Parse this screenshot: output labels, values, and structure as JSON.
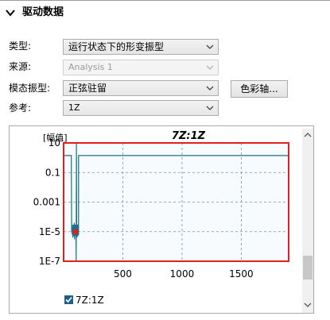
{
  "panel": {
    "title": "驱动数据"
  },
  "form": {
    "type": {
      "label": "类型:",
      "value": "运行状态下的形变振型"
    },
    "source": {
      "label": "来源:",
      "value": "Analysis 1",
      "disabled": true
    },
    "mode": {
      "label": "模态振型:",
      "value": "正弦驻留"
    },
    "reference": {
      "label": "参考:",
      "value": "1Z"
    },
    "color_axis_button": "色彩轴..."
  },
  "chart_data": {
    "type": "line",
    "title": "7Z:1Z",
    "ylabel": "[幅值]",
    "xlabel": "",
    "yscale": "log",
    "ylim": [
      1e-07,
      10
    ],
    "xlim": [
      0,
      1900
    ],
    "yticks": [
      {
        "value": 10,
        "label": "10"
      },
      {
        "value": 0.1,
        "label": "0.1"
      },
      {
        "value": 0.001,
        "label": "0.001"
      },
      {
        "value": 1e-05,
        "label": "1E-5"
      },
      {
        "value": 1e-07,
        "label": "1E-7"
      }
    ],
    "xticks": [
      {
        "value": 500,
        "label": "500"
      },
      {
        "value": 1000,
        "label": "1000"
      },
      {
        "value": 1500,
        "label": "1500"
      }
    ],
    "grid": true,
    "series": [
      {
        "name": "7Z:1Z",
        "color": "#1a6f8a",
        "x": [
          0,
          65,
          68,
          68.5,
          70,
          72,
          74,
          76,
          78,
          80,
          82,
          84,
          86,
          88,
          90,
          92,
          94,
          96,
          98,
          100,
          102,
          104,
          106,
          108,
          110,
          112,
          114,
          116,
          118,
          120,
          122,
          124,
          125,
          126,
          126.5,
          130,
          1900
        ],
        "y": [
          1.4,
          1.4,
          1e-05,
          2e-05,
          8e-06,
          3e-05,
          6e-06,
          2e-05,
          4e-06,
          1e-05,
          3e-05,
          5e-06,
          2e-05,
          7e-06,
          4e-05,
          3e-06,
          2e-05,
          6e-06,
          3e-05,
          1e-05,
          5e-06,
          2e-05,
          1e-07,
          10,
          2e-05,
          4e-06,
          3e-05,
          8e-06,
          2e-05,
          5e-06,
          3e-05,
          1e-05,
          2e-05,
          6e-06,
          1.4,
          1.4,
          1.4
        ]
      }
    ],
    "marker": {
      "x": 100,
      "y": 1e-05,
      "color": "#e02020"
    },
    "legend": {
      "label": "7Z:1Z",
      "checked": true,
      "position": "bottom-left"
    },
    "frame_color": "#e02020"
  }
}
